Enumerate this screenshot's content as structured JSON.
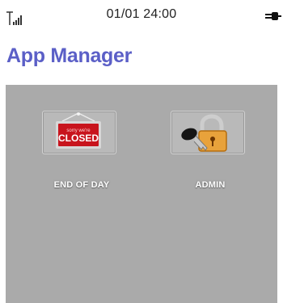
{
  "status_bar": {
    "datetime": "01/01  24:00",
    "signal_icon": "signal-icon",
    "power_icon": "power-plug-icon"
  },
  "header": {
    "title": "App Manager"
  },
  "apps": [
    {
      "label": "END OF DAY",
      "icon": "closed-sign-icon",
      "sign_small_text": "sorry we're",
      "sign_text": "CLOSED"
    },
    {
      "label": "ADMIN",
      "icon": "key-padlock-icon"
    }
  ],
  "colors": {
    "title": "#5b5fc7",
    "main_background": "#aaaaaa",
    "sign_red": "#c8141d"
  }
}
